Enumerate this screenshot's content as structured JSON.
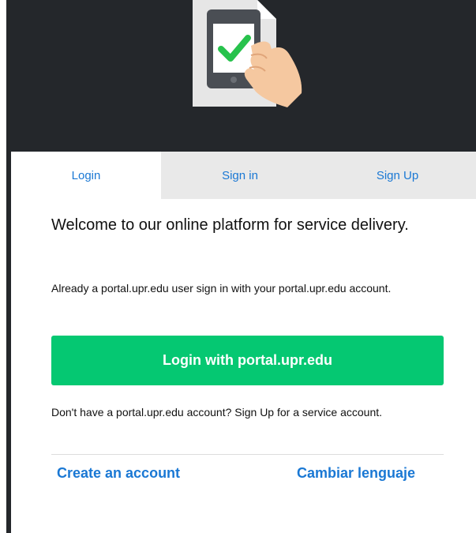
{
  "tabs": [
    {
      "label": "Login"
    },
    {
      "label": "Sign in"
    },
    {
      "label": "Sign Up"
    }
  ],
  "welcome": {
    "title": "Welcome to our online platform for service delivery."
  },
  "info": {
    "already": "Already a portal.upr.edu user sign in with your portal.upr.edu account."
  },
  "login_button": {
    "label": "Login with portal.upr.edu"
  },
  "signup_prompt": {
    "text": "Don't have a portal.upr.edu account? Sign Up for a service account."
  },
  "links": {
    "create": "Create an account",
    "language": "Cambiar lenguaje"
  },
  "colors": {
    "accent": "#1a78d4",
    "button": "#05c872",
    "dark": "#24272b",
    "check": "#27c24c",
    "inactive_tab": "#e9e9e9"
  },
  "icons": {
    "hero": "phone-check-icon"
  }
}
